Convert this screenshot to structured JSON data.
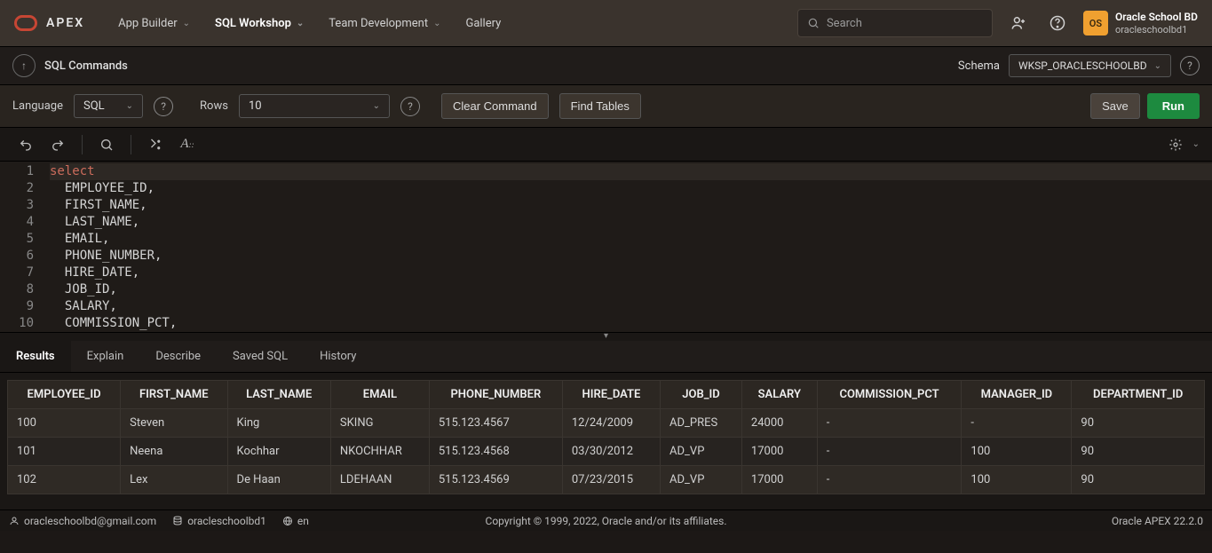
{
  "nav": {
    "logo_text": "APEX",
    "items": [
      "App Builder",
      "SQL Workshop",
      "Team Development",
      "Gallery"
    ],
    "active": 1,
    "search_placeholder": "Search"
  },
  "user": {
    "org": "Oracle School BD",
    "name": "oracleschoolbd1",
    "initials": "OS"
  },
  "subheader": {
    "title": "SQL Commands",
    "schema_label": "Schema",
    "schema_value": "WKSP_ORACLESCHOOLBD"
  },
  "toolbar": {
    "language_label": "Language",
    "language_value": "SQL",
    "rows_label": "Rows",
    "rows_value": "10",
    "clear_label": "Clear Command",
    "find_label": "Find Tables",
    "save_label": "Save",
    "run_label": "Run"
  },
  "editor": {
    "format_small": "A",
    "lines": [
      {
        "n": 1,
        "pre": "",
        "kw": "select",
        "post": ""
      },
      {
        "n": 2,
        "pre": "  ",
        "kw": "",
        "post": "EMPLOYEE_ID,"
      },
      {
        "n": 3,
        "pre": "  ",
        "kw": "",
        "post": "FIRST_NAME,"
      },
      {
        "n": 4,
        "pre": "  ",
        "kw": "",
        "post": "LAST_NAME,"
      },
      {
        "n": 5,
        "pre": "  ",
        "kw": "",
        "post": "EMAIL,"
      },
      {
        "n": 6,
        "pre": "  ",
        "kw": "",
        "post": "PHONE_NUMBER,"
      },
      {
        "n": 7,
        "pre": "  ",
        "kw": "",
        "post": "HIRE_DATE,"
      },
      {
        "n": 8,
        "pre": "  ",
        "kw": "",
        "post": "JOB_ID,"
      },
      {
        "n": 9,
        "pre": "  ",
        "kw": "",
        "post": "SALARY,"
      },
      {
        "n": 10,
        "pre": "  ",
        "kw": "",
        "post": "COMMISSION_PCT,"
      }
    ]
  },
  "results": {
    "tabs": [
      "Results",
      "Explain",
      "Describe",
      "Saved SQL",
      "History"
    ],
    "active": 0,
    "columns": [
      "EMPLOYEE_ID",
      "FIRST_NAME",
      "LAST_NAME",
      "EMAIL",
      "PHONE_NUMBER",
      "HIRE_DATE",
      "JOB_ID",
      "SALARY",
      "COMMISSION_PCT",
      "MANAGER_ID",
      "DEPARTMENT_ID"
    ],
    "rows": [
      [
        "100",
        "Steven",
        "King",
        "SKING",
        "515.123.4567",
        "12/24/2009",
        "AD_PRES",
        "24000",
        "-",
        "-",
        "90"
      ],
      [
        "101",
        "Neena",
        "Kochhar",
        "NKOCHHAR",
        "515.123.4568",
        "03/30/2012",
        "AD_VP",
        "17000",
        "-",
        "100",
        "90"
      ],
      [
        "102",
        "Lex",
        "De Haan",
        "LDEHAAN",
        "515.123.4569",
        "07/23/2015",
        "AD_VP",
        "17000",
        "-",
        "100",
        "90"
      ]
    ]
  },
  "footer": {
    "email": "oracleschoolbd@gmail.com",
    "workspace": "oracleschoolbd1",
    "lang": "en",
    "copyright": "Copyright © 1999, 2022, Oracle and/or its affiliates.",
    "version": "Oracle APEX 22.2.0"
  }
}
